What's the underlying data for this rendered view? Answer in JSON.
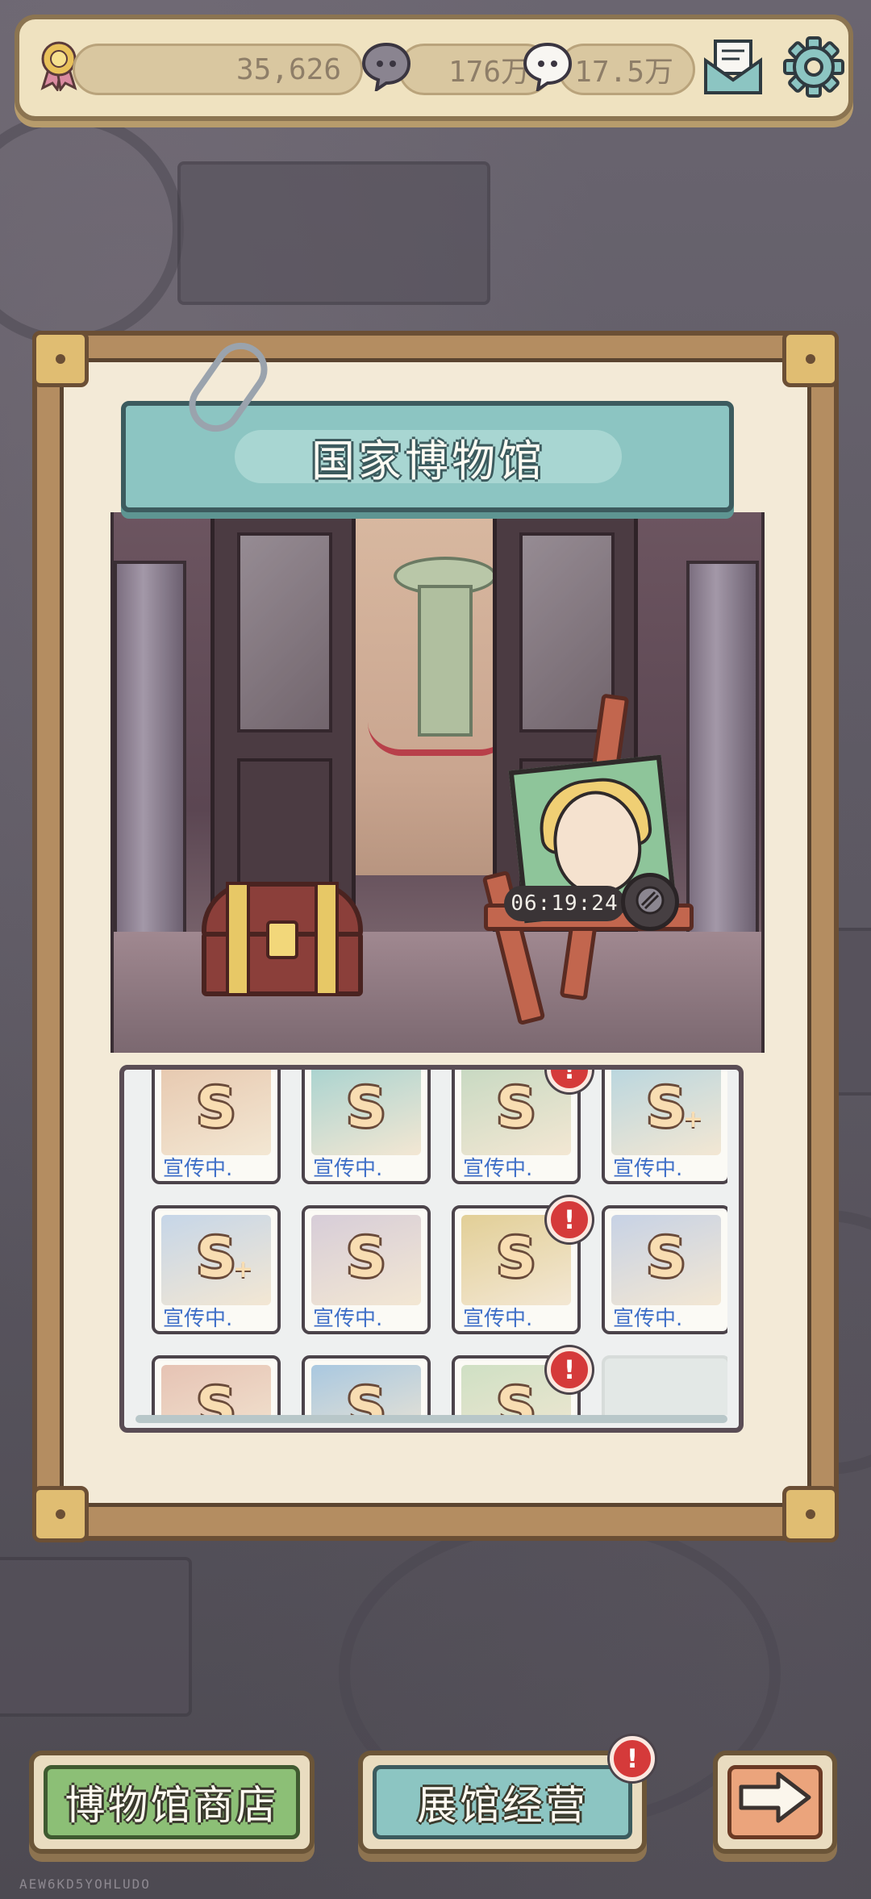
{
  "topbar": {
    "medals": "35,626",
    "gray_bubbles": "176万",
    "white_bubbles": "17.5万",
    "icons": [
      "medal-icon",
      "gray-bubble-icon",
      "white-bubble-icon",
      "mail-icon",
      "gear-icon"
    ]
  },
  "museum": {
    "title": "国家博物馆",
    "timer": "06:19:24"
  },
  "exhibits": {
    "rows": [
      [
        {
          "grade": "S",
          "plus": false,
          "status": "宣传中.",
          "alert": false,
          "tint": "#e7c9b0"
        },
        {
          "grade": "S",
          "plus": false,
          "status": "宣传中.",
          "alert": false,
          "tint": "#a9d3d0"
        },
        {
          "grade": "S",
          "plus": false,
          "status": "宣传中.",
          "alert": true,
          "tint": "#c7d9c2"
        },
        {
          "grade": "S",
          "plus": true,
          "status": "宣传中.",
          "alert": false,
          "tint": "#b9d6df"
        }
      ],
      [
        {
          "grade": "S",
          "plus": true,
          "status": "宣传中.",
          "alert": false,
          "tint": "#c6d6e8"
        },
        {
          "grade": "S",
          "plus": false,
          "status": "宣传中.",
          "alert": false,
          "tint": "#d7cdd8"
        },
        {
          "grade": "S",
          "plus": false,
          "status": "宣传中.",
          "alert": true,
          "tint": "#e2cf97"
        },
        {
          "grade": "S",
          "plus": false,
          "status": "宣传中.",
          "alert": false,
          "tint": "#c7d2e5"
        }
      ],
      [
        {
          "grade": "S",
          "plus": false,
          "status": "",
          "alert": false,
          "tint": "#e6c3b4"
        },
        {
          "grade": "S",
          "plus": false,
          "status": "",
          "alert": false,
          "tint": "#a9c8e0"
        },
        {
          "grade": "S",
          "plus": false,
          "status": "",
          "alert": true,
          "tint": "#cfe0c4"
        },
        {
          "empty": true
        }
      ]
    ]
  },
  "buttons": {
    "shop": "博物馆商店",
    "manage": "展馆经营",
    "next_icon": "arrow-right-icon",
    "manage_alert": "!"
  },
  "alert_symbol": "!",
  "watermark": "AEW6KD5YOHLUDO",
  "colors": {
    "shop_green": "#8cbf76",
    "manage_teal": "#8cc5c2",
    "next_orange": "#eba47c",
    "alert_red": "#d53a3a",
    "status_blue": "#3f6fc8"
  }
}
